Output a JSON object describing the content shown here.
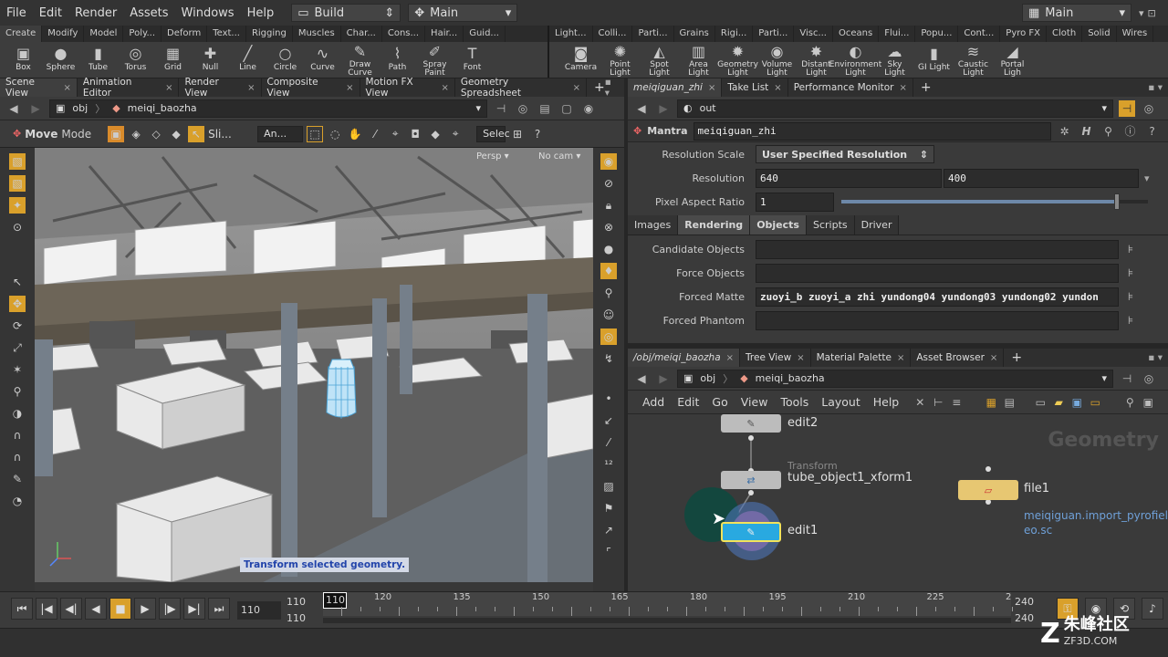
{
  "menu": {
    "items": [
      "File",
      "Edit",
      "Render",
      "Assets",
      "Windows",
      "Help"
    ],
    "desktop": "Build",
    "take": "Main",
    "main_right": "Main"
  },
  "shelf": {
    "left_tabs": [
      "Create",
      "Modify",
      "Model",
      "Poly...",
      "Deform",
      "Text...",
      "Rigging",
      "Muscles",
      "Char...",
      "Cons...",
      "Hair...",
      "Guid..."
    ],
    "right_tabs": [
      "Light...",
      "Colli...",
      "Parti...",
      "Grains",
      "Rigi...",
      "Parti...",
      "Visc...",
      "Oceans",
      "Flui...",
      "Popu...",
      "Cont...",
      "Pyro FX",
      "Cloth",
      "Solid",
      "Wires"
    ],
    "left_tools": [
      {
        "label": "Box",
        "icon": "box-icon"
      },
      {
        "label": "Sphere",
        "icon": "sphere-icon"
      },
      {
        "label": "Tube",
        "icon": "tube-icon"
      },
      {
        "label": "Torus",
        "icon": "torus-icon"
      },
      {
        "label": "Grid",
        "icon": "grid-icon"
      },
      {
        "label": "Null",
        "icon": "null-icon"
      },
      {
        "label": "Line",
        "icon": "line-icon"
      },
      {
        "label": "Circle",
        "icon": "circle-icon"
      },
      {
        "label": "Curve",
        "icon": "curve-icon"
      },
      {
        "label": "Draw Curve",
        "icon": "draw-curve-icon"
      },
      {
        "label": "Path",
        "icon": "path-icon"
      },
      {
        "label": "Spray Paint",
        "icon": "spray-paint-icon"
      },
      {
        "label": "Font",
        "icon": "font-icon"
      }
    ],
    "right_tools": [
      {
        "label": "Camera",
        "icon": "camera-icon"
      },
      {
        "label": "Point Light",
        "icon": "point-light-icon"
      },
      {
        "label": "Spot Light",
        "icon": "spot-light-icon"
      },
      {
        "label": "Area Light",
        "icon": "area-light-icon"
      },
      {
        "label": "Geometry Light",
        "icon": "geometry-light-icon"
      },
      {
        "label": "Volume Light",
        "icon": "volume-light-icon"
      },
      {
        "label": "Distant Light",
        "icon": "distant-light-icon"
      },
      {
        "label": "Environment Light",
        "icon": "environment-light-icon"
      },
      {
        "label": "Sky Light",
        "icon": "sky-light-icon"
      },
      {
        "label": "GI Light",
        "icon": "gi-light-icon"
      },
      {
        "label": "Caustic Light",
        "icon": "caustic-light-icon"
      },
      {
        "label": "Portal Ligh",
        "icon": "portal-light-icon"
      }
    ]
  },
  "left_pane": {
    "tabs": [
      "Scene View",
      "Animation Editor",
      "Render View",
      "Composite View",
      "Motion FX View",
      "Geometry Spreadsheet"
    ],
    "path_root": "obj",
    "path_node": "meiqi_baozha",
    "tool_name": "Move",
    "tool_mode": "Mode",
    "slider_label": "Sli...",
    "an_label": "An...",
    "select_label": "Selec",
    "persp": "Persp",
    "cam": "No cam",
    "status": "Transform selected geometry."
  },
  "right_top": {
    "tabs": [
      "meiqiguan_zhi",
      "Take List",
      "Performance Monitor"
    ],
    "path": "out",
    "node_type": "Mantra",
    "node_name": "meiqiguan_zhi",
    "resolution_scale_label": "Resolution Scale",
    "resolution_scale_value": "User Specified Resolution",
    "resolution_label": "Resolution",
    "res_x": "640",
    "res_y": "400",
    "pixel_aspect_label": "Pixel Aspect Ratio",
    "pixel_aspect_value": "1",
    "pixel_aspect_slider": 0.9,
    "parm_tabs": [
      "Images",
      "Rendering",
      "Objects",
      "Scripts",
      "Driver"
    ],
    "candidate_label": "Candidate Objects",
    "candidate_value": "",
    "force_label": "Force Objects",
    "force_value": "",
    "matte_label": "Forced Matte",
    "matte_value": "zuoyi_b zuoyi_a zhi yundong04 yundong03 yundong02 yundon",
    "phantom_label": "Forced Phantom",
    "phantom_value": ""
  },
  "network": {
    "tabs": [
      "/obj/meiqi_baozha",
      "Tree View",
      "Material Palette",
      "Asset Browser"
    ],
    "path_root": "obj",
    "path_node": "meiqi_baozha",
    "menu": [
      "Add",
      "Edit",
      "Go",
      "View",
      "Tools",
      "Layout",
      "Help"
    ],
    "watermark": "Geometry",
    "nodes": {
      "edit2": "edit2",
      "xform_type": "Transform",
      "xform": "tube_object1_xform1",
      "edit1": "edit1",
      "file1": "file1",
      "file_path1": "meiqiguan.import_pyrofields",
      "file_path2": "eo.sc"
    }
  },
  "timeline": {
    "frame": "110",
    "start": "110",
    "start2": "110",
    "end": "240",
    "end2": "240",
    "current": "110",
    "ticks": [
      "120",
      "135",
      "150",
      "165",
      "180",
      "195",
      "210",
      "225",
      "2"
    ]
  },
  "logo": {
    "text": "朱峰社区",
    "sub": "ZF3D.COM"
  }
}
